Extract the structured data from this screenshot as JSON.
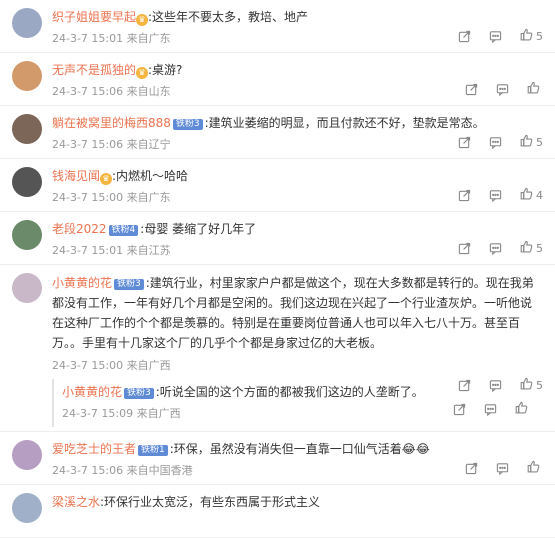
{
  "comments": [
    {
      "user": "织子姐姐要早起",
      "badge": "",
      "crown": true,
      "text": ":这些年不要太多，教培、地产",
      "time": "24-3-7 15:01",
      "location": "来自广东",
      "likes": "5",
      "avatar": "#9aa8c4"
    },
    {
      "user": "无声不是孤独的",
      "badge": "",
      "crown": true,
      "text": ":桌游?",
      "time": "24-3-7 15:06",
      "location": "来自山东",
      "likes": "",
      "avatar": "#d29a6b"
    },
    {
      "user": "躺在被窝里的梅西888",
      "badge": "铁粉3",
      "crown": false,
      "text": ":建筑业萎缩的明显，而且付款还不好，垫款是常态。",
      "time": "24-3-7 15:06",
      "location": "来自辽宁",
      "likes": "5",
      "avatar": "#7b6658"
    },
    {
      "user": "钱海见闻",
      "badge": "",
      "crown": true,
      "text": ":内燃机～哈哈",
      "time": "24-3-7 15:00",
      "location": "来自广东",
      "likes": "4",
      "avatar": "#555555"
    },
    {
      "user": "老段2022",
      "badge": "铁粉4",
      "crown": false,
      "text": ":母婴 萎缩了好几年了",
      "time": "24-3-7 15:01",
      "location": "来自江苏",
      "likes": "5",
      "avatar": "#6a8a6a"
    },
    {
      "user": "小黄黄的花",
      "badge": "铁粉3",
      "crown": false,
      "text": ":建筑行业，村里家家户户都是做这个，现在大多数都是转行的。现在我弟都没有工作，一年有好几个月都是空闲的。我们这边现在兴起了一个行业渣灰炉。一听他说在这种厂工作的个个都是羡慕的。特别是在重要岗位普通人也可以年入七八十万。甚至百万。。手里有十几家这个厂的几乎个个都是身家过亿的大老板。",
      "time": "24-3-7 15:00",
      "location": "来自广西",
      "likes": "5",
      "avatar": "#c8b8c8",
      "reply": {
        "user": "小黄黄的花",
        "badge": "铁粉3",
        "text": ":听说全国的这个方面的都被我们这边的人垄断了。",
        "time": "24-3-7 15:09",
        "location": "来自广西",
        "likes": ""
      }
    },
    {
      "user": "爱吃芝士的王者",
      "badge": "铁粉1",
      "crown": false,
      "text": ":环保，虽然没有消失但一直靠一口仙气活着😂😂",
      "time": "24-3-7 15:06",
      "location": "来自中国香港",
      "likes": "",
      "avatar": "#b69dc2"
    },
    {
      "user": "梁溪之水",
      "badge": "",
      "crown": false,
      "text": ":环保行业太宽泛，有些东西属于形式主义",
      "time": "",
      "location": "",
      "likes": "",
      "avatar": "#a0b0c8"
    }
  ]
}
